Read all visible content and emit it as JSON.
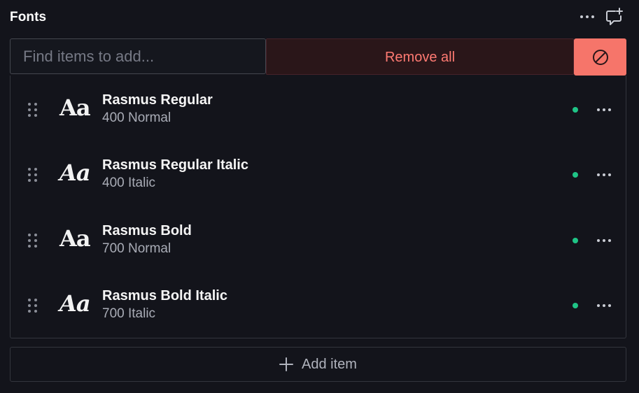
{
  "header": {
    "title": "Fonts",
    "more_icon": "ellipsis-icon",
    "comment_icon": "comment-add-icon"
  },
  "toolbar": {
    "search_placeholder": "Find items to add...",
    "search_value": "",
    "remove_all_label": "Remove all",
    "disable_icon": "ban-icon"
  },
  "list": {
    "items": [
      {
        "preview": "Aa",
        "name": "Rasmus Regular",
        "meta": "400 Normal",
        "italic": false
      },
      {
        "preview": "Aa",
        "name": "Rasmus Regular Italic",
        "meta": "400 Italic",
        "italic": true
      },
      {
        "preview": "Aa",
        "name": "Rasmus Bold",
        "meta": "700 Normal",
        "italic": false
      },
      {
        "preview": "Aa",
        "name": "Rasmus Bold Italic",
        "meta": "700 Italic",
        "italic": true
      }
    ]
  },
  "footer": {
    "add_item_label": "Add item",
    "add_icon": "plus-icon"
  },
  "colors": {
    "background": "#13141b",
    "danger": "#f6756a",
    "danger_text": "#ff7a72",
    "status_green": "#1fc486"
  }
}
